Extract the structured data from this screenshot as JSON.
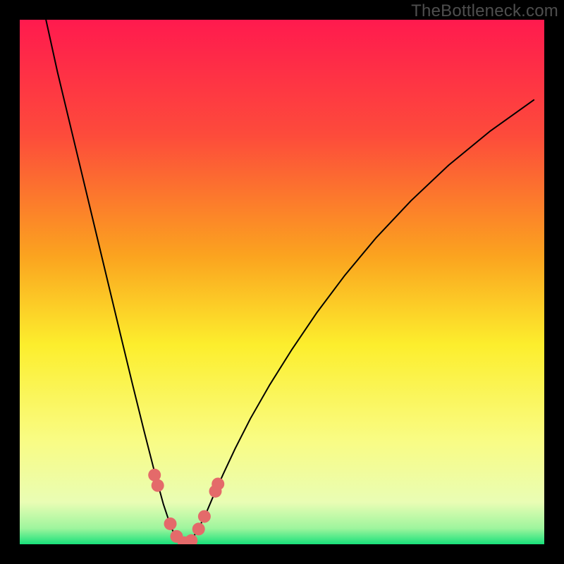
{
  "watermark": "TheBottleneck.com",
  "chart_data": {
    "type": "line",
    "title": "",
    "xlabel": "",
    "ylabel": "",
    "xlim": [
      0,
      100
    ],
    "ylim": [
      0,
      100
    ],
    "background_gradient": {
      "stops": [
        {
          "offset": 0.0,
          "color": "#ff1a4e"
        },
        {
          "offset": 0.22,
          "color": "#fd4b3b"
        },
        {
          "offset": 0.45,
          "color": "#fba31f"
        },
        {
          "offset": 0.62,
          "color": "#fcee2d"
        },
        {
          "offset": 0.8,
          "color": "#f9fc83"
        },
        {
          "offset": 0.92,
          "color": "#e9fdb4"
        },
        {
          "offset": 0.97,
          "color": "#9df59d"
        },
        {
          "offset": 1.0,
          "color": "#18e07a"
        }
      ]
    },
    "series": [
      {
        "name": "bottleneck-curve",
        "color": "#000000",
        "stroke_width": 2,
        "x": [
          5.0,
          7.2,
          9.6,
          12.0,
          14.4,
          16.8,
          19.2,
          21.5,
          23.7,
          25.7,
          27.4,
          28.8,
          29.8,
          30.6,
          31.3,
          32.0,
          33.1,
          34.3,
          35.6,
          37.0,
          38.8,
          41.1,
          44.0,
          47.6,
          51.8,
          56.6,
          62.0,
          68.0,
          74.6,
          81.8,
          89.6,
          98.0
        ],
        "y": [
          100.0,
          90.0,
          80.0,
          70.0,
          60.0,
          50.0,
          40.0,
          30.5,
          21.6,
          13.8,
          7.6,
          3.4,
          1.2,
          0.3,
          0.1,
          0.3,
          1.4,
          3.4,
          6.1,
          9.4,
          13.4,
          18.3,
          24.0,
          30.3,
          37.0,
          44.1,
          51.3,
          58.5,
          65.5,
          72.3,
          78.7,
          84.7
        ]
      }
    ],
    "markers": {
      "color": "#e46a6a",
      "radius": 9,
      "points": [
        {
          "x": 25.7,
          "y": 13.2
        },
        {
          "x": 26.3,
          "y": 11.2
        },
        {
          "x": 28.7,
          "y": 3.9
        },
        {
          "x": 29.9,
          "y": 1.5
        },
        {
          "x": 31.3,
          "y": 0.3
        },
        {
          "x": 32.7,
          "y": 0.7
        },
        {
          "x": 34.1,
          "y": 2.9
        },
        {
          "x": 35.2,
          "y": 5.3
        },
        {
          "x": 37.3,
          "y": 10.1
        },
        {
          "x": 37.8,
          "y": 11.5
        }
      ]
    }
  }
}
